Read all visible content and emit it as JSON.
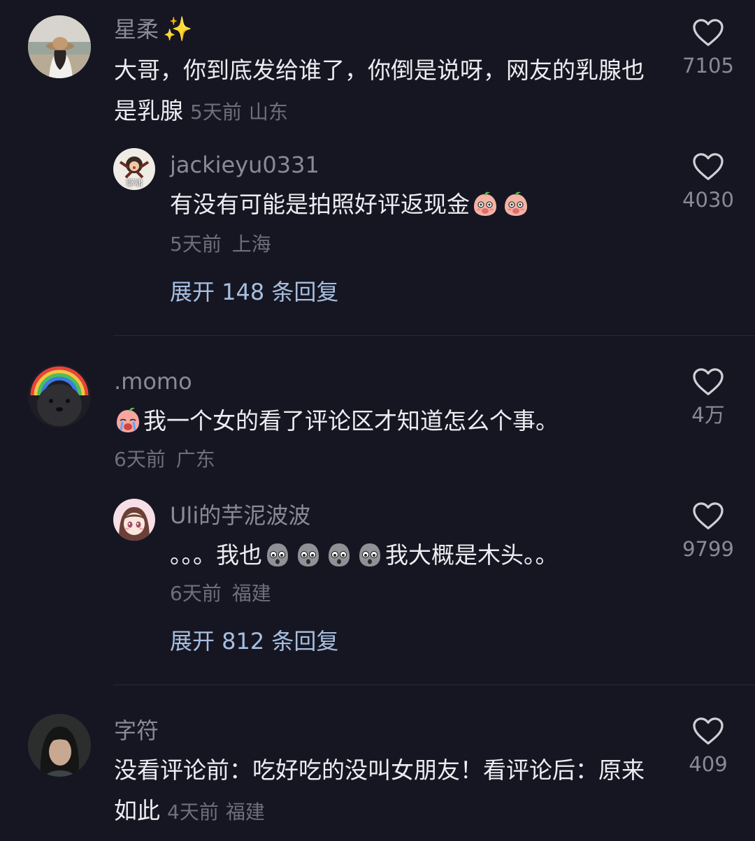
{
  "comments": [
    {
      "user": "星柔",
      "sparkle": "✨",
      "text": "大哥，你到底发给谁了，你倒是说呀，网友的乳腺也是乳腺",
      "time": "5天前",
      "location": "山东",
      "likes": "7105",
      "reply": {
        "user": "jackieyu0331",
        "avatar_text": "耶啸",
        "text": "有没有可能是拍照好评返现金",
        "emojis": [
          "shy-laugh-emoji",
          "shy-laugh-emoji"
        ],
        "time": "5天前",
        "location": "上海",
        "likes": "4030"
      },
      "expand_label": "展开 148 条回复"
    },
    {
      "user": ".momo",
      "lead_emoji": "crying-emoji",
      "text": "我一个女的看了评论区才知道怎么个事。",
      "time": "6天前",
      "location": "广东",
      "likes": "4万",
      "reply": {
        "user": "Uli的芋泥波波",
        "text_prefix": "。。。我也",
        "emojis": [
          "shocked-potato-emoji",
          "shocked-potato-emoji",
          "shocked-potato-emoji",
          "shocked-potato-emoji"
        ],
        "text_suffix": "我大概是木头。。",
        "time": "6天前",
        "location": "福建",
        "likes": "9799"
      },
      "expand_label": "展开 812 条回复"
    },
    {
      "user": "字符",
      "text": "没看评论前：吃好吃的没叫女朋友！看评论后：原来如此",
      "time": "4天前",
      "location": "福建",
      "likes": "409"
    }
  ],
  "colors": {
    "background": "#161622",
    "username": "#8a8a96",
    "text": "#ececf2",
    "meta": "#6f6f7b",
    "expand": "#a7bfe0"
  },
  "icons": {
    "like": "heart-outline-icon"
  }
}
